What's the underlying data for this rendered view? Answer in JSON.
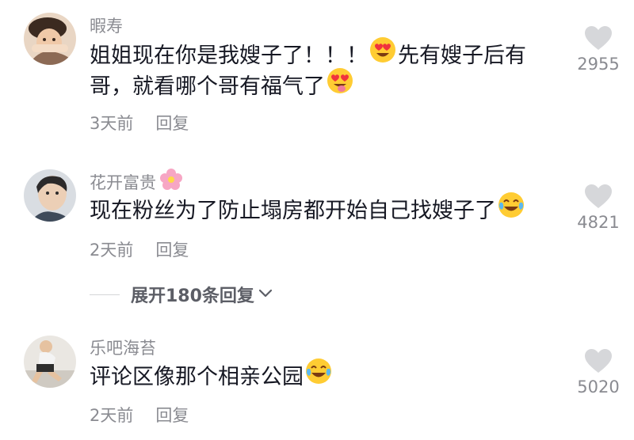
{
  "comments": [
    {
      "username": "暇寿",
      "text_line1_a": "姐姐现在你是我嫂子了！！！",
      "text_line1_b": "先有嫂子后有",
      "text_line2": "哥，就看哪个哥有福气了",
      "time": "3天前",
      "reply": "回复",
      "likes": "2955",
      "emojis": [
        "heart-eyes-emoji",
        "heart-eyes-tongue-emoji"
      ]
    },
    {
      "username": "花开富贵",
      "username_icon": "pink-flower-icon",
      "text": "现在粉丝为了防止塌房都开始自己找嫂子了",
      "time": "2天前",
      "reply": "回复",
      "likes": "4821",
      "emojis": [
        "tears-of-joy-emoji"
      ]
    },
    {
      "username": "乐吧海苔",
      "text": "评论区像那个相亲公园",
      "time": "2天前",
      "reply": "回复",
      "likes": "5020",
      "emojis": [
        "tears-of-joy-emoji"
      ]
    }
  ],
  "expand_replies": {
    "label": "展开180条回复",
    "icon": "chevron-down-icon"
  },
  "colors": {
    "text_primary": "#161823",
    "text_secondary": "#8a8b91",
    "heart_gray": "#c8c9cc",
    "emoji_yellow": "#ffcc33"
  }
}
